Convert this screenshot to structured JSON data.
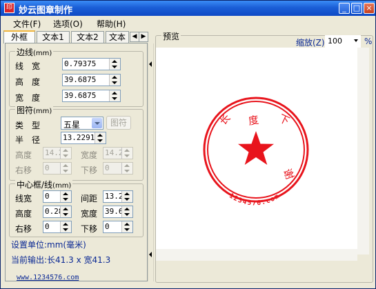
{
  "window": {
    "title": "妙云图章制作",
    "icon_glyph": "印"
  },
  "titlebar_buttons": {
    "minimize": "_",
    "maximize": "□",
    "close": "×"
  },
  "menu": [
    "文件(F)",
    "选项(O)",
    "帮助(H)"
  ],
  "tabs": [
    "外框",
    "文本1",
    "文本2",
    "文本"
  ],
  "border_group": {
    "legend": "边线",
    "unit": "(mm)",
    "fields": [
      {
        "label": "线　宽",
        "value": "0.79375"
      },
      {
        "label": "高　度",
        "value": "39.6875"
      },
      {
        "label": "宽　度",
        "value": "39.6875"
      }
    ]
  },
  "symbol_group": {
    "legend": "图符",
    "unit": "(mm)",
    "type_label": "类　型",
    "type_value": "五星",
    "symbol_button": "图符",
    "radius_label": "半　径",
    "radius_value": "13.2291",
    "height_label": "高度",
    "height_value": "14.2",
    "width_label": "宽度",
    "width_value": "14.2",
    "right_label": "右移",
    "right_value": "0",
    "down_label": "下移",
    "down_value": "0"
  },
  "center_group": {
    "legend": "中心框/线",
    "unit": "(mm)",
    "linewidth_label": "线宽",
    "linewidth_value": "0",
    "spacing_label": "间距",
    "spacing_value": "13.2",
    "height_label": "高度",
    "height_value": "0.28",
    "width_label": "宽度",
    "width_value": "39.6",
    "right_label": "右移",
    "right_value": "0",
    "down_label": "下移",
    "down_value": "0"
  },
  "unit_setting": "设置单位:mm(毫米)",
  "output_size": "当前输出:长41.3 x 宽41.3",
  "website": "www.1234576.com",
  "preview": {
    "legend": "预览",
    "zoom_label": "缩放(Z)",
    "zoom_value": "100",
    "zoom_unit": "%"
  },
  "stamp": {
    "color": "#e8141c",
    "arc_chars": [
      "长",
      "度",
      "下",
      "谢"
    ],
    "bottom_text": "1234576.com"
  }
}
